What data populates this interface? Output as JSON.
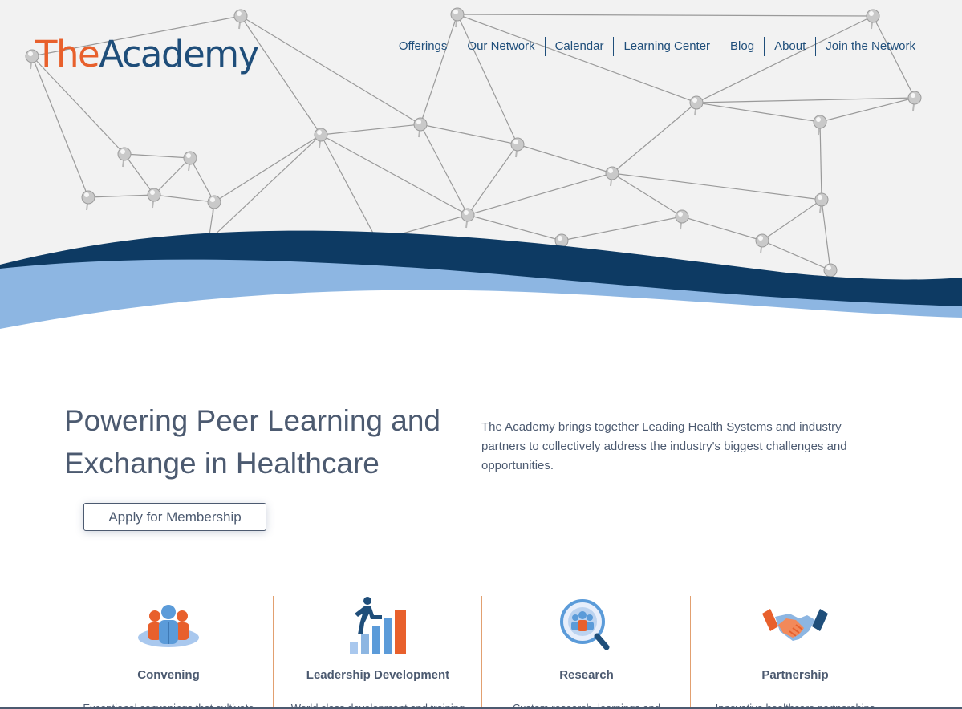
{
  "logo": {
    "part1": "The",
    "part2": "Academy"
  },
  "nav": {
    "items": [
      {
        "label": "Offerings"
      },
      {
        "label": "Our Network"
      },
      {
        "label": "Calendar"
      },
      {
        "label": "Learning Center"
      },
      {
        "label": "Blog"
      },
      {
        "label": "About"
      },
      {
        "label": "Join the Network"
      }
    ]
  },
  "hero": {
    "headline": "Powering Peer Learning and Exchange in Healthcare",
    "description": "The Academy brings together Leading Health Systems and industry partners to collectively address the industry's biggest challenges and opportunities.",
    "cta_label": "Apply for Membership"
  },
  "features": [
    {
      "title": "Convening",
      "icon": "people-group-icon",
      "desc_partial": "Exceptional convenings that cultivate"
    },
    {
      "title": "Leadership Development",
      "icon": "climbing-stairs-icon",
      "desc_partial": "World class development and training"
    },
    {
      "title": "Research",
      "icon": "magnifier-people-icon",
      "desc_partial": "Custom research, learnings and"
    },
    {
      "title": "Partnership",
      "icon": "handshake-icon",
      "desc_partial": "Innovative healthcare partnerships"
    }
  ],
  "colors": {
    "brand_orange": "#e8602c",
    "brand_navy": "#1f4e7a",
    "text": "#4c5a70",
    "wave_dark": "#0d3a63",
    "wave_light": "#8db6e2"
  }
}
